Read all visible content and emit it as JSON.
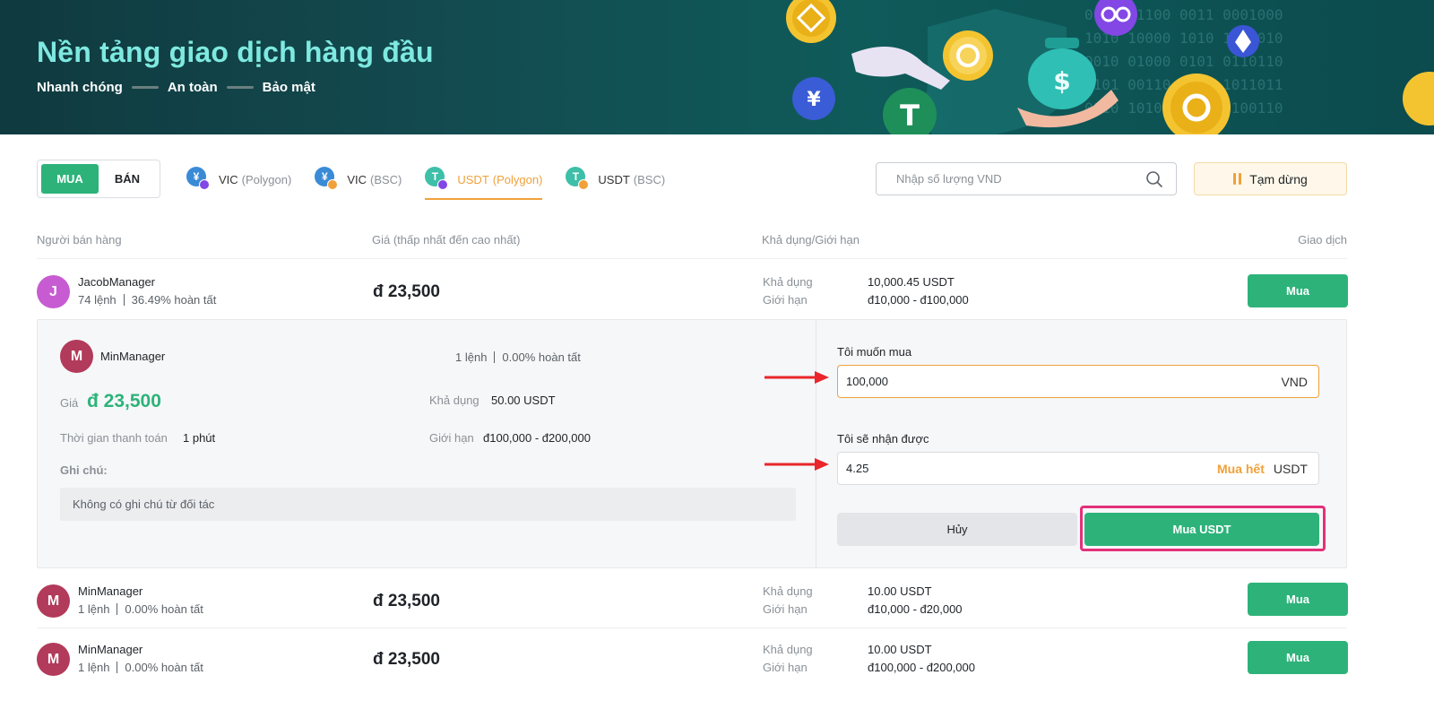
{
  "banner": {
    "title": "Nền tảng giao dịch hàng đầu",
    "tagline": [
      "Nhanh chóng",
      "An toàn",
      "Bảo mật"
    ]
  },
  "trade_toggle": {
    "buy": "MUA",
    "sell": "BÁN",
    "active": "buy"
  },
  "asset_tabs": [
    {
      "coin": "VIC",
      "network": "(Polygon)",
      "icon": "vic-polygon-icon",
      "active": false
    },
    {
      "coin": "VIC",
      "network": "(BSC)",
      "icon": "vic-bsc-icon",
      "active": false
    },
    {
      "coin": "USDT",
      "network": "(Polygon)",
      "icon": "usdt-polygon-icon",
      "active": true
    },
    {
      "coin": "USDT",
      "network": "(BSC)",
      "icon": "usdt-bsc-icon",
      "active": false
    }
  ],
  "search": {
    "placeholder": "Nhập số lượng VND"
  },
  "pause_button": "Tạm dừng",
  "table_headers": {
    "seller": "Người bán hàng",
    "price": "Giá (thấp nhất đến cao nhất)",
    "available_limit": "Khả dụng/Giới hạn",
    "trade": "Giao dịch"
  },
  "labels": {
    "available": "Khả dụng",
    "limit": "Giới hạn",
    "buy": "Mua"
  },
  "rows": [
    {
      "initial": "J",
      "name": "JacobManager",
      "orders": "74 lệnh",
      "completion": "36.49% hoàn tất",
      "price": "đ 23,500",
      "available": "10,000.45 USDT",
      "limit": "đ10,000 - đ100,000"
    },
    {
      "initial": "M",
      "name": "MinManager",
      "orders": "1 lệnh",
      "completion": "0.00% hoàn tất",
      "price": "đ 23,500",
      "available": "10.00 USDT",
      "limit": "đ10,000 - đ20,000"
    },
    {
      "initial": "M",
      "name": "MinManager",
      "orders": "1 lệnh",
      "completion": "0.00% hoàn tất",
      "price": "đ 23,500",
      "available": "10.00 USDT",
      "limit": "đ100,000 - đ200,000"
    }
  ],
  "detail": {
    "initial": "M",
    "name": "MinManager",
    "orders": "1 lệnh",
    "completion": "0.00% hoàn tất",
    "price_label": "Giá",
    "price": "đ 23,500",
    "payment_time_label": "Thời gian thanh toán",
    "payment_time": "1 phút",
    "available_label": "Khả dụng",
    "available": "50.00 USDT",
    "limit_label": "Giới hạn",
    "limit": "đ100,000 - đ200,000",
    "note_label": "Ghi chú:",
    "note": "Không có ghi chú từ đối tác",
    "want_buy_label": "Tôi muốn mua",
    "want_buy_value": "100,000",
    "want_buy_unit": "VND",
    "receive_label": "Tôi sẽ nhận được",
    "receive_value": "4.25",
    "buy_all": "Mua hết",
    "receive_unit": "USDT",
    "cancel": "Hủy",
    "confirm": "Mua USDT"
  },
  "colors": {
    "green": "#2db37a",
    "orange": "#f0a13a",
    "highlight": "#e4307a",
    "arrow": "#e8262b",
    "banner_title": "#7ee9e0"
  }
}
